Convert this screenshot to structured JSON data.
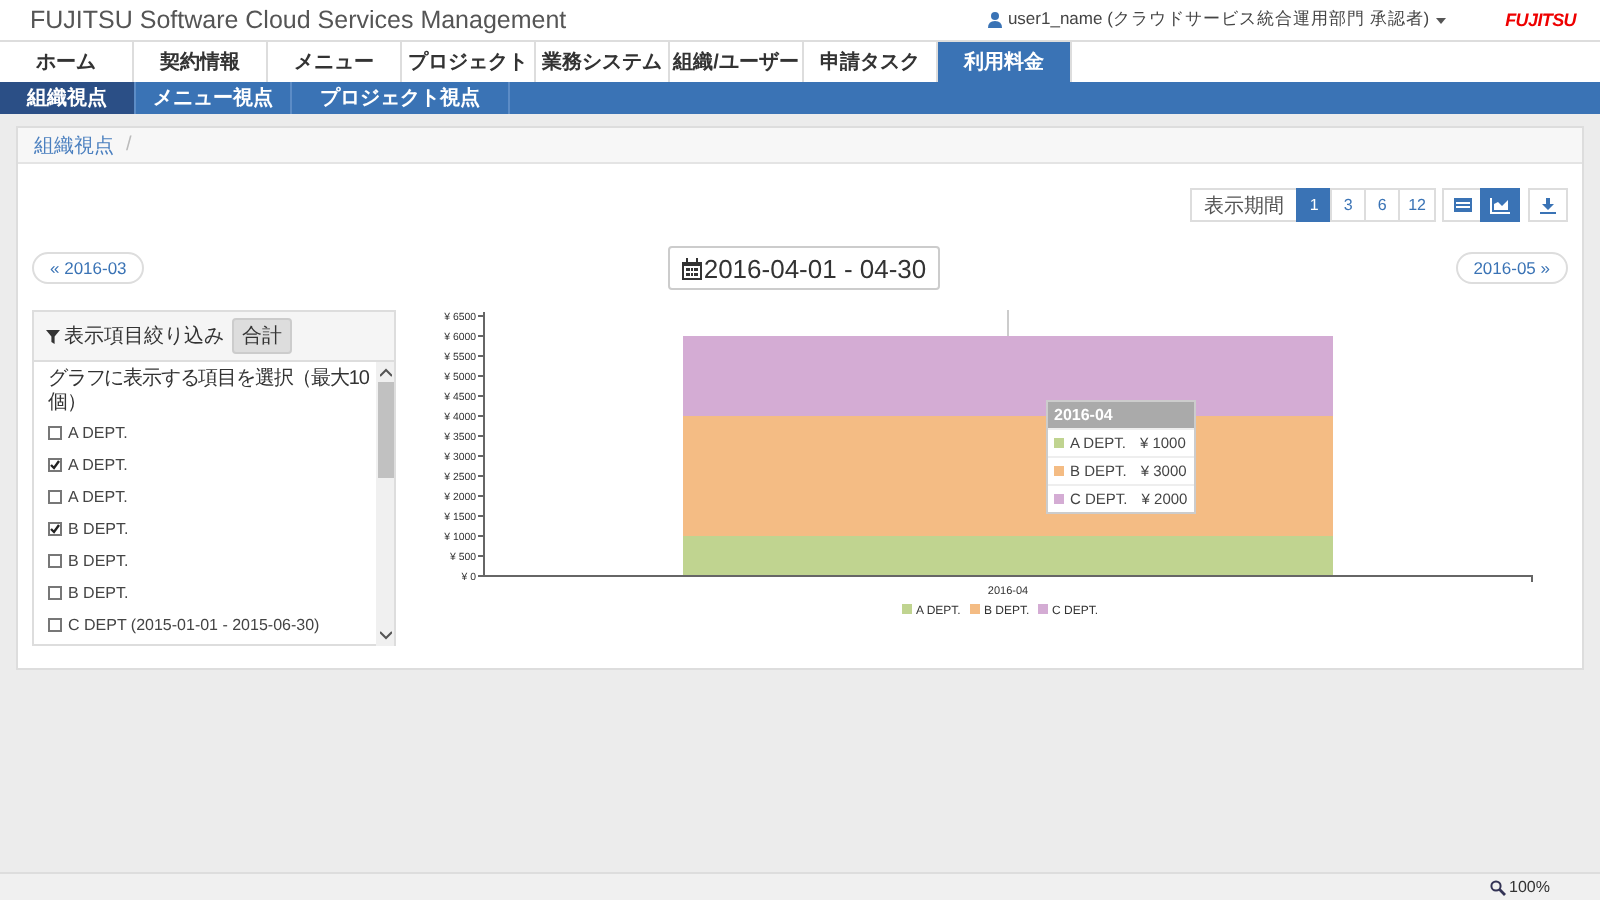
{
  "header": {
    "title": "FUJITSU Software Cloud Services Management",
    "user": "user1_name (クラウドサービス統合運用部門 承認者)",
    "logo": "FUJITSU"
  },
  "tabs": [
    {
      "label": "ホーム",
      "selected": false
    },
    {
      "label": "契約情報",
      "selected": false
    },
    {
      "label": "メニュー",
      "selected": false
    },
    {
      "label": "プロジェクト",
      "selected": false
    },
    {
      "label": "業務システム",
      "selected": false
    },
    {
      "label": "組織/ユーザー",
      "selected": false
    },
    {
      "label": "申請タスク",
      "selected": false
    },
    {
      "label": "利用料金",
      "selected": true
    }
  ],
  "subtabs": [
    {
      "label": "組織視点",
      "selected": true
    },
    {
      "label": "メニュー視点",
      "selected": false
    },
    {
      "label": "プロジェクト視点",
      "selected": false
    }
  ],
  "breadcrumb": {
    "items": [
      "組織視点"
    ],
    "separator": "/"
  },
  "toolbar": {
    "period_label": "表示期間",
    "periods": [
      {
        "label": "1",
        "selected": true
      },
      {
        "label": "3",
        "selected": false
      },
      {
        "label": "6",
        "selected": false
      },
      {
        "label": "12",
        "selected": false
      }
    ],
    "views": [
      {
        "kind": "table",
        "selected": false
      },
      {
        "kind": "chart",
        "selected": true
      }
    ]
  },
  "navigation": {
    "prev": "« 2016-03",
    "range": "2016-04-01 - 04-30",
    "next": "2016-05 »"
  },
  "filter": {
    "title": "表示項目絞り込み",
    "total_button": "合計",
    "hint": "グラフに表示する項目を選択（最大10個）",
    "items": [
      {
        "label": "A DEPT.",
        "checked": false
      },
      {
        "label": "A DEPT.",
        "checked": true
      },
      {
        "label": "A DEPT.",
        "checked": false
      },
      {
        "label": "B DEPT.",
        "checked": true
      },
      {
        "label": "B DEPT.",
        "checked": false
      },
      {
        "label": "B DEPT.",
        "checked": false
      },
      {
        "label": "C DEPT (2015-01-01 - 2015-06-30)",
        "checked": false
      }
    ]
  },
  "chart": {
    "chart_data": {
      "type": "bar",
      "stacked": true,
      "legend": true,
      "categories": [
        "2016-04"
      ],
      "series": [
        {
          "name": "A DEPT.",
          "color": "#c0d490",
          "values": [
            1000
          ]
        },
        {
          "name": "B DEPT.",
          "color": "#f4bc84",
          "values": [
            3000
          ]
        },
        {
          "name": "C DEPT.",
          "color": "#d4acd4",
          "values": [
            2000
          ]
        }
      ],
      "ylim": [
        0,
        6500
      ],
      "yticks": [
        {
          "value": 0,
          "label": "¥ 0"
        },
        {
          "value": 500,
          "label": "¥ 500"
        },
        {
          "value": 1000,
          "label": "¥ 1000"
        },
        {
          "value": 1500,
          "label": "¥ 1500"
        },
        {
          "value": 2000,
          "label": "¥ 2000"
        },
        {
          "value": 2500,
          "label": "¥ 2500"
        },
        {
          "value": 3000,
          "label": "¥ 3000"
        },
        {
          "value": 3500,
          "label": "¥ 3500"
        },
        {
          "value": 4000,
          "label": "¥ 4000"
        },
        {
          "value": 4500,
          "label": "¥ 4500"
        },
        {
          "value": 5000,
          "label": "¥ 5000"
        },
        {
          "value": 5500,
          "label": "¥ 5500"
        },
        {
          "value": 6000,
          "label": "¥ 6000"
        },
        {
          "value": 6500,
          "label": "¥ 6500"
        }
      ]
    },
    "tooltip": {
      "title": "2016-04",
      "rows": [
        {
          "label": "A DEPT.",
          "value": "¥ 1000"
        },
        {
          "label": "B DEPT.",
          "value": "¥ 3000"
        },
        {
          "label": "C DEPT.",
          "value": "¥ 2000"
        }
      ]
    }
  },
  "status_bar": {
    "zoom": "100%"
  }
}
